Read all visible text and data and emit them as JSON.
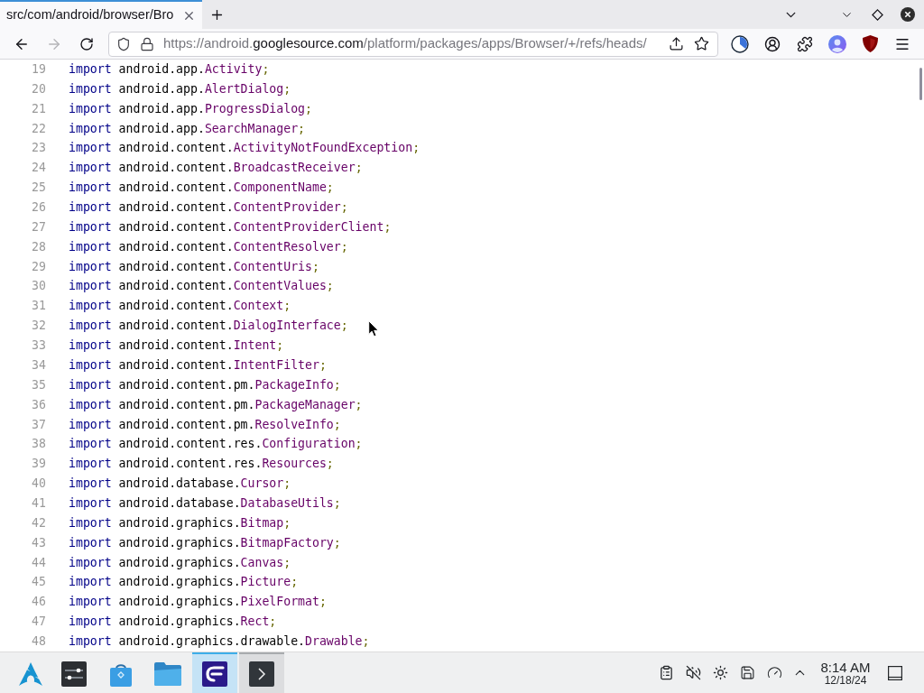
{
  "browser": {
    "tabs": [
      {
        "title": "src/com/android/browser/Bro",
        "selected": true
      }
    ],
    "navigation": {
      "back": {
        "disabled": false
      },
      "forward": {
        "disabled": true
      }
    },
    "address_bar": {
      "url_start": "https://android.",
      "url_domain": "googlesource.com",
      "url_rest": "/platform/packages/apps/Browser/+/refs/heads/"
    }
  },
  "code": {
    "lines": [
      {
        "number": "19",
        "keyword": "import",
        "package": "android.app.",
        "type": "Activity",
        "end": ";"
      },
      {
        "number": "20",
        "keyword": "import",
        "package": "android.app.",
        "type": "AlertDialog",
        "end": ";"
      },
      {
        "number": "21",
        "keyword": "import",
        "package": "android.app.",
        "type": "ProgressDialog",
        "end": ";"
      },
      {
        "number": "22",
        "keyword": "import",
        "package": "android.app.",
        "type": "SearchManager",
        "end": ";"
      },
      {
        "number": "23",
        "keyword": "import",
        "package": "android.content.",
        "type": "ActivityNotFoundException",
        "end": ";"
      },
      {
        "number": "24",
        "keyword": "import",
        "package": "android.content.",
        "type": "BroadcastReceiver",
        "end": ";"
      },
      {
        "number": "25",
        "keyword": "import",
        "package": "android.content.",
        "type": "ComponentName",
        "end": ";"
      },
      {
        "number": "26",
        "keyword": "import",
        "package": "android.content.",
        "type": "ContentProvider",
        "end": ";"
      },
      {
        "number": "27",
        "keyword": "import",
        "package": "android.content.",
        "type": "ContentProviderClient",
        "end": ";"
      },
      {
        "number": "28",
        "keyword": "import",
        "package": "android.content.",
        "type": "ContentResolver",
        "end": ";"
      },
      {
        "number": "29",
        "keyword": "import",
        "package": "android.content.",
        "type": "ContentUris",
        "end": ";"
      },
      {
        "number": "30",
        "keyword": "import",
        "package": "android.content.",
        "type": "ContentValues",
        "end": ";"
      },
      {
        "number": "31",
        "keyword": "import",
        "package": "android.content.",
        "type": "Context",
        "end": ";"
      },
      {
        "number": "32",
        "keyword": "import",
        "package": "android.content.",
        "type": "DialogInterface",
        "end": ";"
      },
      {
        "number": "33",
        "keyword": "import",
        "package": "android.content.",
        "type": "Intent",
        "end": ";"
      },
      {
        "number": "34",
        "keyword": "import",
        "package": "android.content.",
        "type": "IntentFilter",
        "end": ";"
      },
      {
        "number": "35",
        "keyword": "import",
        "package": "android.content.pm.",
        "type": "PackageInfo",
        "end": ";"
      },
      {
        "number": "36",
        "keyword": "import",
        "package": "android.content.pm.",
        "type": "PackageManager",
        "end": ";"
      },
      {
        "number": "37",
        "keyword": "import",
        "package": "android.content.pm.",
        "type": "ResolveInfo",
        "end": ";"
      },
      {
        "number": "38",
        "keyword": "import",
        "package": "android.content.res.",
        "type": "Configuration",
        "end": ";"
      },
      {
        "number": "39",
        "keyword": "import",
        "package": "android.content.res.",
        "type": "Resources",
        "end": ";"
      },
      {
        "number": "40",
        "keyword": "import",
        "package": "android.database.",
        "type": "Cursor",
        "end": ";"
      },
      {
        "number": "41",
        "keyword": "import",
        "package": "android.database.",
        "type": "DatabaseUtils",
        "end": ";"
      },
      {
        "number": "42",
        "keyword": "import",
        "package": "android.graphics.",
        "type": "Bitmap",
        "end": ";"
      },
      {
        "number": "43",
        "keyword": "import",
        "package": "android.graphics.",
        "type": "BitmapFactory",
        "end": ";"
      },
      {
        "number": "44",
        "keyword": "import",
        "package": "android.graphics.",
        "type": "Canvas",
        "end": ";"
      },
      {
        "number": "45",
        "keyword": "import",
        "package": "android.graphics.",
        "type": "Picture",
        "end": ";"
      },
      {
        "number": "46",
        "keyword": "import",
        "package": "android.graphics.",
        "type": "PixelFormat",
        "end": ";"
      },
      {
        "number": "47",
        "keyword": "import",
        "package": "android.graphics.",
        "type": "Rect",
        "end": ";"
      },
      {
        "number": "48",
        "keyword": "import",
        "package": "android.graphics.drawable.",
        "type": "Drawable",
        "end": ";"
      }
    ]
  },
  "taskbar": {
    "items": [
      {
        "kind": "launcher",
        "selected": false,
        "open": false
      },
      {
        "kind": "settings",
        "selected": false,
        "open": false
      },
      {
        "kind": "store",
        "selected": false,
        "open": false
      },
      {
        "kind": "files",
        "selected": false,
        "open": false
      },
      {
        "kind": "app",
        "selected": true,
        "open": true
      },
      {
        "kind": "terminal",
        "selected": false,
        "open": true
      }
    ],
    "clock": {
      "time": "8:14 AM",
      "date": "12/18/24"
    }
  }
}
